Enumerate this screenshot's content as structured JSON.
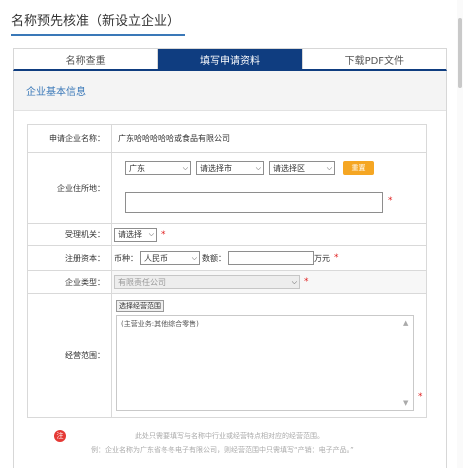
{
  "page": {
    "title": "名称预先核准（新设立企业）"
  },
  "tabs": [
    {
      "label": "名称查重",
      "active": false
    },
    {
      "label": "填写申请资料",
      "active": true
    },
    {
      "label": "下载PDF文件",
      "active": false
    }
  ],
  "section": {
    "title": "企业基本信息"
  },
  "form": {
    "company_name": {
      "label": "申请企业名称：",
      "value": "广东哈哈哈哈哈或食品有限公司"
    },
    "address": {
      "label": "企业住所地：",
      "province": "广东",
      "city": "请选择市",
      "district": "请选择区",
      "reset_label": "重置",
      "detail_value": ""
    },
    "authority": {
      "label": "受理机关：",
      "value": "请选择"
    },
    "capital": {
      "label": "注册资本：",
      "currency_label": "币种：",
      "currency_value": "人民币",
      "amount_label": "数额：",
      "amount_value": "",
      "unit": "万元"
    },
    "company_type": {
      "label": "企业类型：",
      "value": "有限责任公司"
    },
    "scope": {
      "label": "经营范围：",
      "button_label": "选择经营范围",
      "value": "(主营业务:其他综合零售)"
    },
    "required_mark": "*"
  },
  "hint": {
    "icon_text": "注",
    "line1": "此处只需要填写与名称中行业或经营特点相对应的经营范围。",
    "line2": "例：企业名称为广东省冬冬电子有限公司，则经营范围中只需填写“产销：电子产品。”"
  },
  "colors": {
    "accent": "#0f3d80",
    "link": "#3a78b8",
    "required": "#e02020",
    "reset": "#f5a623"
  }
}
